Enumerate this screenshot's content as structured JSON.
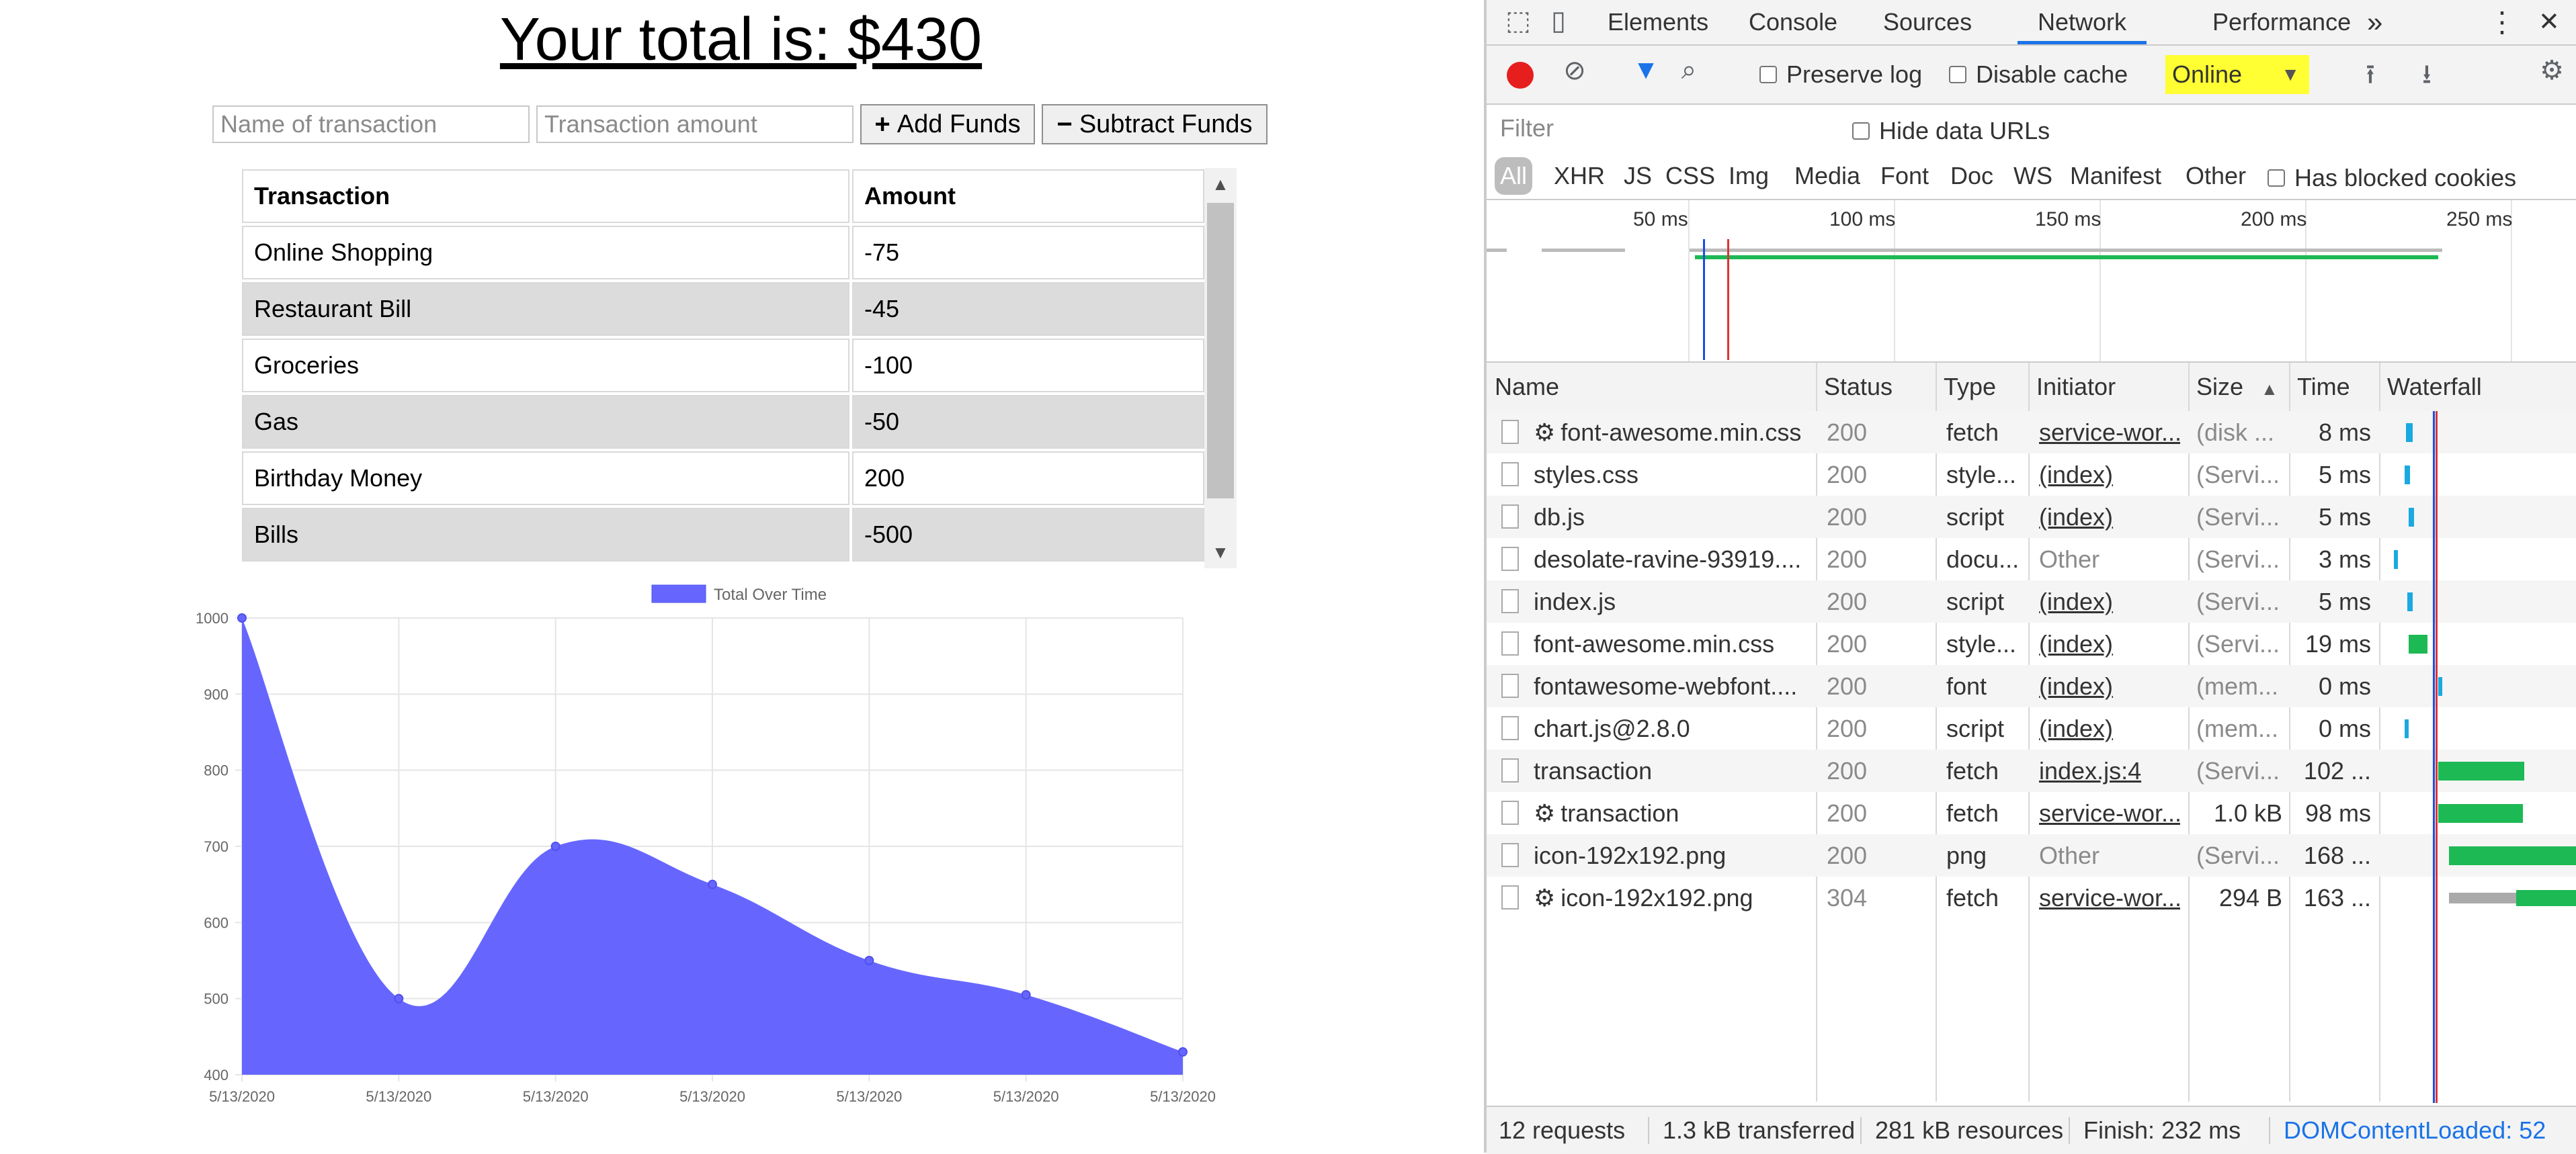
{
  "app": {
    "total_text": "Your total is: $430",
    "name_placeholder": "Name of transaction",
    "amount_placeholder": "Transaction amount",
    "add_label": "Add Funds",
    "subtract_label": "Subtract Funds",
    "add_glyph": "+",
    "subtract_glyph": "−",
    "table": {
      "headers": [
        "Transaction",
        "Amount"
      ],
      "rows": [
        {
          "name": "Online Shopping",
          "amount": "-75"
        },
        {
          "name": "Restaurant Bill",
          "amount": "-45"
        },
        {
          "name": "Groceries",
          "amount": "-100"
        },
        {
          "name": "Gas",
          "amount": "-50"
        },
        {
          "name": "Birthday Money",
          "amount": "200"
        },
        {
          "name": "Bills",
          "amount": "-500"
        }
      ]
    }
  },
  "chart_data": {
    "type": "area",
    "legend": "Total Over Time",
    "legend_position": "top-center",
    "color": "#6666ff",
    "x": [
      "5/13/2020",
      "5/13/2020",
      "5/13/2020",
      "5/13/2020",
      "5/13/2020",
      "5/13/2020",
      "5/13/2020"
    ],
    "y": [
      1000,
      500,
      700,
      650,
      550,
      505,
      430
    ],
    "ylim": [
      400,
      1000
    ],
    "yticks": [
      400,
      500,
      600,
      700,
      800,
      900,
      1000
    ],
    "grid": true,
    "smooth": true
  },
  "devtools": {
    "tabs": [
      "Elements",
      "Console",
      "Sources",
      "Network",
      "Performance"
    ],
    "active_tab": "Network",
    "more_tabs_glyph": "»",
    "menu_glyph": "⋮",
    "close_glyph": "✕",
    "preserve_log": "Preserve log",
    "disable_cache": "Disable cache",
    "throttle": "Online",
    "throttle_arrow": "▼",
    "filter_placeholder": "Filter",
    "hide_data_urls": "Hide data URLs",
    "type_filters": [
      "All",
      "XHR",
      "JS",
      "CSS",
      "Img",
      "Media",
      "Font",
      "Doc",
      "WS",
      "Manifest",
      "Other"
    ],
    "has_blocked_cookies": "Has blocked cookies",
    "overview_ticks": [
      "50 ms",
      "100 ms",
      "150 ms",
      "200 ms",
      "250 ms"
    ],
    "columns": [
      "Name",
      "Status",
      "Type",
      "Initiator",
      "Size",
      "Time",
      "Waterfall"
    ],
    "sort_glyph": "▲",
    "requests": [
      {
        "name": "font-awesome.min.css",
        "sw": true,
        "status": "200",
        "type": "fetch",
        "initiator": "service-wor...",
        "initiator_link": true,
        "size": "(disk ...",
        "size_dim": true,
        "time": "8 ms"
      },
      {
        "name": "styles.css",
        "sw": false,
        "status": "200",
        "type": "style...",
        "initiator": "(index)",
        "initiator_link": true,
        "size": "(Servi...",
        "size_dim": true,
        "time": "5 ms"
      },
      {
        "name": "db.js",
        "sw": false,
        "status": "200",
        "type": "script",
        "initiator": "(index)",
        "initiator_link": true,
        "size": "(Servi...",
        "size_dim": true,
        "time": "5 ms"
      },
      {
        "name": "desolate-ravine-93919....",
        "sw": false,
        "status": "200",
        "type": "docu...",
        "initiator": "Other",
        "initiator_link": false,
        "size": "(Servi...",
        "size_dim": true,
        "time": "3 ms"
      },
      {
        "name": "index.js",
        "sw": false,
        "status": "200",
        "type": "script",
        "initiator": "(index)",
        "initiator_link": true,
        "size": "(Servi...",
        "size_dim": true,
        "time": "5 ms"
      },
      {
        "name": "font-awesome.min.css",
        "sw": false,
        "status": "200",
        "type": "style...",
        "initiator": "(index)",
        "initiator_link": true,
        "size": "(Servi...",
        "size_dim": true,
        "time": "19 ms"
      },
      {
        "name": "fontawesome-webfont....",
        "sw": false,
        "status": "200",
        "type": "font",
        "initiator": "(index)",
        "initiator_link": true,
        "size": "(mem...",
        "size_dim": true,
        "time": "0 ms"
      },
      {
        "name": "chart.js@2.8.0",
        "sw": false,
        "status": "200",
        "type": "script",
        "initiator": "(index)",
        "initiator_link": true,
        "size": "(mem...",
        "size_dim": true,
        "time": "0 ms"
      },
      {
        "name": "transaction",
        "sw": false,
        "status": "200",
        "type": "fetch",
        "initiator": "index.js:4",
        "initiator_link": true,
        "size": "(Servi...",
        "size_dim": true,
        "time": "102 ..."
      },
      {
        "name": "transaction",
        "sw": true,
        "status": "200",
        "type": "fetch",
        "initiator": "service-wor...",
        "initiator_link": true,
        "size": "1.0 kB",
        "size_dim": false,
        "time": "98 ms"
      },
      {
        "name": "icon-192x192.png",
        "sw": false,
        "status": "200",
        "type": "png",
        "initiator": "Other",
        "initiator_link": false,
        "size": "(Servi...",
        "size_dim": true,
        "time": "168 ..."
      },
      {
        "name": "icon-192x192.png",
        "sw": true,
        "status": "304",
        "type": "fetch",
        "initiator": "service-wor...",
        "initiator_link": true,
        "size": "294 B",
        "size_dim": false,
        "time": "163 ..."
      }
    ],
    "status_bar": {
      "requests": "12 requests",
      "transferred": "1.3 kB transferred",
      "resources": "281 kB resources",
      "finish": "Finish: 232 ms",
      "dcl": "DOMContentLoaded: 52"
    },
    "sw_glyph": "⚙"
  }
}
